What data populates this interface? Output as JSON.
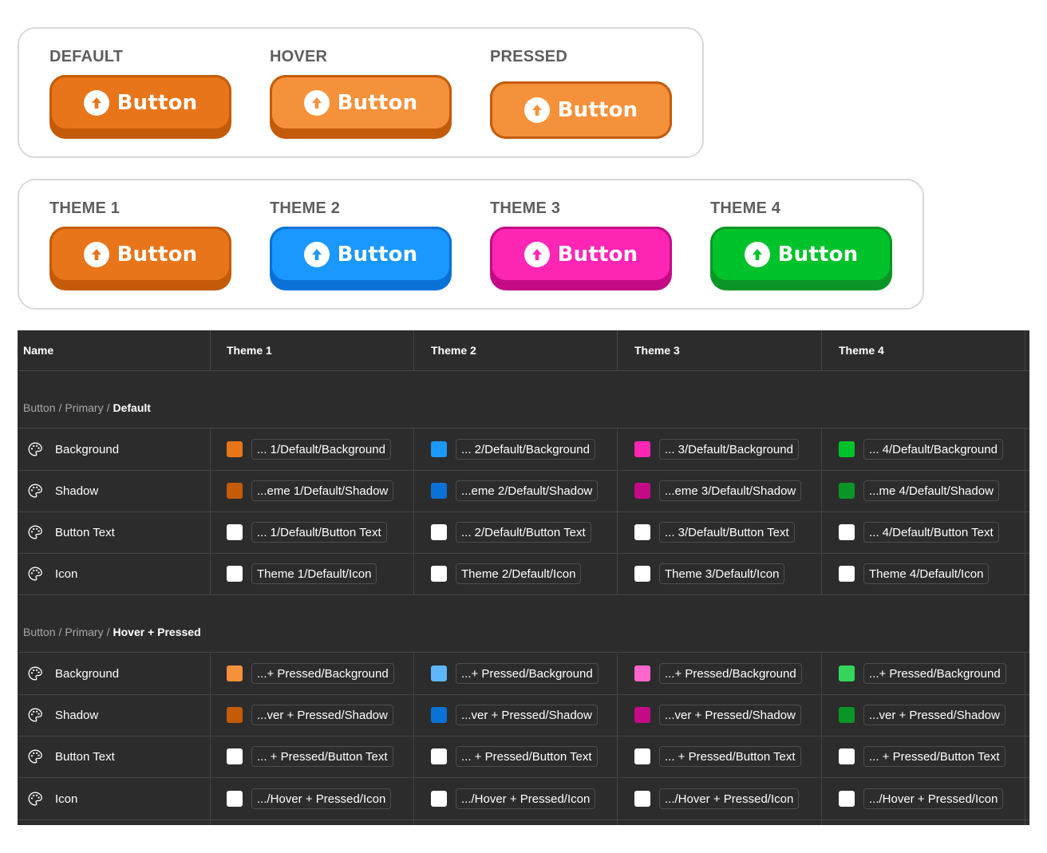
{
  "colors": {
    "orange_default": "#e8751a",
    "orange_shadow": "#c45b08",
    "orange_hover": "#f5913a",
    "blue_default": "#1b98fd",
    "blue_shadow": "#0a72d6",
    "blue_hover": "#5eb6fd",
    "pink_default": "#ff26b6",
    "pink_shadow": "#c40b85",
    "pink_hover": "#ff66cc",
    "green_default": "#00c22a",
    "green_shadow": "#0a9626",
    "green_hover": "#33d65a",
    "white": "#ffffff",
    "table_bg": "#2c2c2c"
  },
  "states_card": {
    "items": [
      {
        "label": "DEFAULT",
        "button_text": "Button",
        "icon": "arrow-up-circle-icon",
        "state": "default"
      },
      {
        "label": "HOVER",
        "button_text": "Button",
        "icon": "arrow-up-circle-icon",
        "state": "hover"
      },
      {
        "label": "PRESSED",
        "button_text": "Button",
        "icon": "arrow-up-circle-icon",
        "state": "pressed"
      }
    ]
  },
  "themes_card": {
    "items": [
      {
        "label": "THEME 1",
        "button_text": "Button",
        "icon": "arrow-up-circle-icon",
        "face": "#e8751a",
        "shadow": "#c45b08"
      },
      {
        "label": "THEME 2",
        "button_text": "Button",
        "icon": "arrow-up-circle-icon",
        "face": "#1b98fd",
        "shadow": "#0a72d6"
      },
      {
        "label": "THEME 3",
        "button_text": "Button",
        "icon": "arrow-up-circle-icon",
        "face": "#ff26b6",
        "shadow": "#c40b85"
      },
      {
        "label": "THEME 4",
        "button_text": "Button",
        "icon": "arrow-up-circle-icon",
        "face": "#00c22a",
        "shadow": "#0a9626"
      }
    ]
  },
  "table": {
    "headers": [
      "Name",
      "Theme 1",
      "Theme 2",
      "Theme 3",
      "Theme 4"
    ],
    "groups": [
      {
        "path_1": "Button",
        "path_2": "Primary",
        "path_3": "Default",
        "rows": [
          {
            "name": "Background",
            "icon": "palette-icon",
            "cells": [
              {
                "swatch": "#e8751a",
                "alias": "... 1/Default/Background"
              },
              {
                "swatch": "#1b98fd",
                "alias": "... 2/Default/Background"
              },
              {
                "swatch": "#ff26b6",
                "alias": "... 3/Default/Background"
              },
              {
                "swatch": "#00c22a",
                "alias": "... 4/Default/Background"
              }
            ]
          },
          {
            "name": "Shadow",
            "icon": "palette-icon",
            "cells": [
              {
                "swatch": "#c45b08",
                "alias": "...eme 1/Default/Shadow"
              },
              {
                "swatch": "#0a72d6",
                "alias": "...eme 2/Default/Shadow"
              },
              {
                "swatch": "#c40b85",
                "alias": "...eme 3/Default/Shadow"
              },
              {
                "swatch": "#0a9626",
                "alias": "...me 4/Default/Shadow"
              }
            ]
          },
          {
            "name": "Button Text",
            "icon": "palette-icon",
            "cells": [
              {
                "swatch": "#ffffff",
                "alias": "... 1/Default/Button Text"
              },
              {
                "swatch": "#ffffff",
                "alias": "... 2/Default/Button Text"
              },
              {
                "swatch": "#ffffff",
                "alias": "... 3/Default/Button Text"
              },
              {
                "swatch": "#ffffff",
                "alias": "... 4/Default/Button Text"
              }
            ]
          },
          {
            "name": "Icon",
            "icon": "palette-icon",
            "cells": [
              {
                "swatch": "#ffffff",
                "alias": "Theme 1/Default/Icon"
              },
              {
                "swatch": "#ffffff",
                "alias": "Theme 2/Default/Icon"
              },
              {
                "swatch": "#ffffff",
                "alias": "Theme 3/Default/Icon"
              },
              {
                "swatch": "#ffffff",
                "alias": "Theme 4/Default/Icon"
              }
            ]
          }
        ]
      },
      {
        "path_1": "Button",
        "path_2": "Primary",
        "path_3": "Hover + Pressed",
        "rows": [
          {
            "name": "Background",
            "icon": "palette-icon",
            "cells": [
              {
                "swatch": "#f5913a",
                "alias": "...+ Pressed/Background"
              },
              {
                "swatch": "#5eb6fd",
                "alias": "...+ Pressed/Background"
              },
              {
                "swatch": "#ff66cc",
                "alias": "...+ Pressed/Background"
              },
              {
                "swatch": "#33d65a",
                "alias": "...+ Pressed/Background"
              }
            ]
          },
          {
            "name": "Shadow",
            "icon": "palette-icon",
            "cells": [
              {
                "swatch": "#c45b08",
                "alias": "...ver + Pressed/Shadow"
              },
              {
                "swatch": "#0a72d6",
                "alias": "...ver + Pressed/Shadow"
              },
              {
                "swatch": "#c40b85",
                "alias": "...ver + Pressed/Shadow"
              },
              {
                "swatch": "#0a9626",
                "alias": "...ver + Pressed/Shadow"
              }
            ]
          },
          {
            "name": "Button Text",
            "icon": "palette-icon",
            "cells": [
              {
                "swatch": "#ffffff",
                "alias": "... + Pressed/Button Text"
              },
              {
                "swatch": "#ffffff",
                "alias": "... + Pressed/Button Text"
              },
              {
                "swatch": "#ffffff",
                "alias": "... + Pressed/Button Text"
              },
              {
                "swatch": "#ffffff",
                "alias": "... + Pressed/Button Text"
              }
            ]
          },
          {
            "name": "Icon",
            "icon": "palette-icon",
            "cells": [
              {
                "swatch": "#ffffff",
                "alias": ".../Hover + Pressed/Icon"
              },
              {
                "swatch": "#ffffff",
                "alias": ".../Hover + Pressed/Icon"
              },
              {
                "swatch": "#ffffff",
                "alias": ".../Hover + Pressed/Icon"
              },
              {
                "swatch": "#ffffff",
                "alias": ".../Hover + Pressed/Icon"
              }
            ]
          }
        ]
      }
    ]
  }
}
